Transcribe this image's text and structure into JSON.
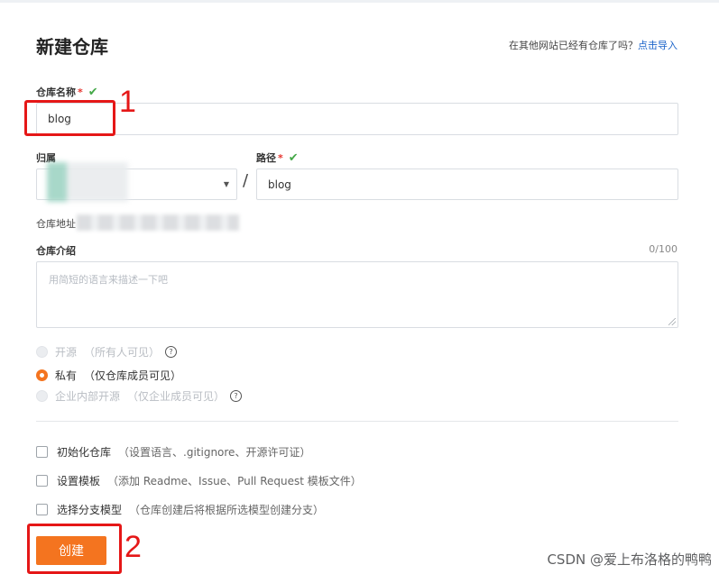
{
  "header": {
    "title": "新建仓库",
    "import_hint": "在其他网站已经有仓库了吗？",
    "import_link": "点击导入"
  },
  "form": {
    "repo_name": {
      "label": "仓库名称",
      "required_mark": "*",
      "value": "blog"
    },
    "owner": {
      "label": "归属",
      "value": ""
    },
    "separator": "/",
    "path": {
      "label": "路径",
      "required_mark": "*",
      "value": "blog"
    },
    "repo_address": {
      "label": "仓库地址"
    },
    "description": {
      "label": "仓库介绍",
      "count": "0/100",
      "placeholder": "用简短的语言来描述一下吧"
    },
    "visibility": {
      "options": [
        {
          "label": "开源",
          "hint": "（所有人可见）",
          "selected": false,
          "disabled": true,
          "help": "?"
        },
        {
          "label": "私有",
          "hint": "（仅仓库成员可见）",
          "selected": true,
          "disabled": false
        },
        {
          "label": "企业内部开源",
          "hint": "（仅企业成员可见）",
          "selected": false,
          "disabled": true,
          "help": "?"
        }
      ]
    },
    "options": [
      {
        "label": "初始化仓库",
        "hint": "（设置语言、.gitignore、开源许可证）",
        "checked": false
      },
      {
        "label": "设置模板",
        "hint": "（添加 Readme、Issue、Pull Request 模板文件）",
        "checked": false
      },
      {
        "label": "选择分支模型",
        "hint": "（仓库创建后将根据所选模型创建分支）",
        "checked": false
      }
    ],
    "submit_label": "创建"
  },
  "annotations": {
    "one": "1",
    "two": "2"
  },
  "watermark": "CSDN @爱上布洛格的鸭鸭",
  "colors": {
    "accent": "#f4741f",
    "annotation": "#e51717",
    "link": "#1a63c9",
    "success": "#44a848"
  }
}
